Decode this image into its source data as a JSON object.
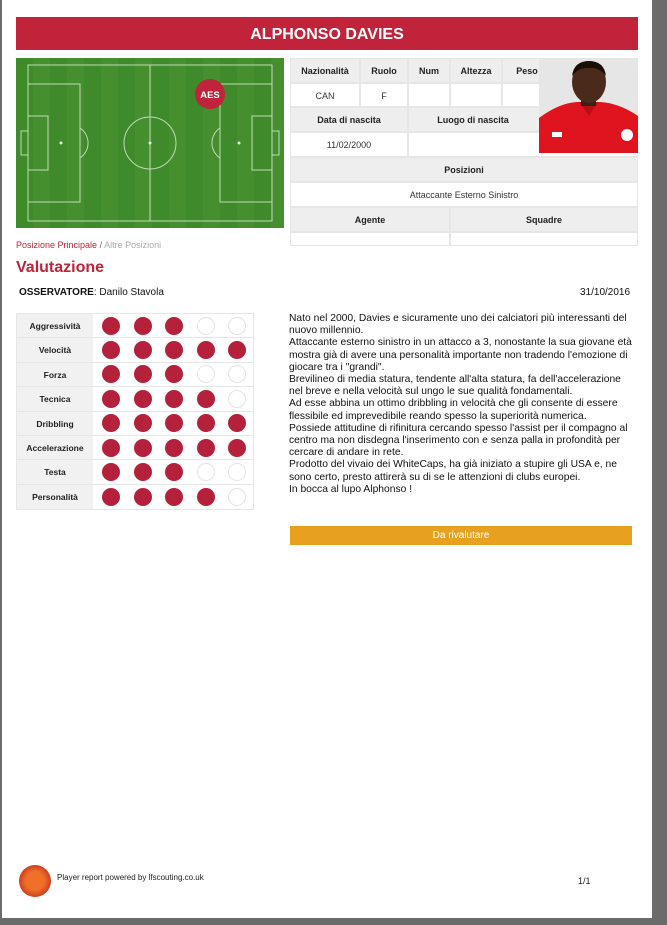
{
  "player": {
    "name": "ALPHONSO DAVIES"
  },
  "pitch": {
    "marker": "AES",
    "marker_color": "#c1233a"
  },
  "info": {
    "headers1": [
      "Nazionalità",
      "Ruolo",
      "Num",
      "Altezza",
      "Peso"
    ],
    "values1": [
      "CAN",
      "F",
      "",
      "",
      ""
    ],
    "headers2": [
      "Data di nascita",
      "Luogo di nascita"
    ],
    "values2": [
      "11/02/2000",
      ""
    ],
    "posizioni_label": "Posizioni",
    "posizioni_value": "Attaccante Esterno Sinistro",
    "headers3": [
      "Agente",
      "Squadre"
    ],
    "values3": [
      "",
      ""
    ]
  },
  "positions": {
    "primary": "Posizione Principale",
    "separator": "/",
    "other": "Altre Posizioni"
  },
  "evaluation": {
    "title": "Valutazione",
    "observer_label": "OSSERVATORE",
    "observer": ": Danilo Stavola",
    "date": "31/10/2016",
    "max": 5,
    "ratings": [
      {
        "label": "Aggressività",
        "value": 3
      },
      {
        "label": "Velocità",
        "value": 5
      },
      {
        "label": "Forza",
        "value": 3
      },
      {
        "label": "Tecnica",
        "value": 4
      },
      {
        "label": "Dribbling",
        "value": 5
      },
      {
        "label": "Accelerazione",
        "value": 5
      },
      {
        "label": "Testa",
        "value": 3
      },
      {
        "label": "Personalità",
        "value": 4
      }
    ],
    "description": [
      "Nato nel 2000, Davies e sicuramente uno dei calciatori più interessanti del nuovo millennio.",
      "Attaccante esterno sinistro in un attacco a 3, nonostante la sua giovane età mostra già di avere una personalità importante non tradendo l'emozione di giocare tra i \"grandi\".",
      "Brevilineo di media statura, tendente all'alta statura, fa dell'accelerazione nel breve e nella velocità sul ungo le sue qualità fondamentali.",
      "Ad esse abbina un ottimo dribbling in velocità che gli consente di essere flessibile ed imprevedibile reando spesso la superiorità numerica.",
      "Possiede attitudine di rifinitura cercando spesso l'assist per il compagno al centro ma non disdegna l'inserimento con e senza palla in profondità per cercare di andare in rete.",
      "Prodotto del vivaio dei WhiteCaps, ha già iniziato a stupire gli USA e, ne sono certo, presto attirerà su di se le attenzioni di clubs europei.",
      "In bocca al lupo Alphonso !"
    ],
    "verdict": "Da rivalutare",
    "verdict_color": "#e8a11f"
  },
  "footer": {
    "powered": "Player report powered by lfscouting.co.uk",
    "page": "1/1"
  }
}
